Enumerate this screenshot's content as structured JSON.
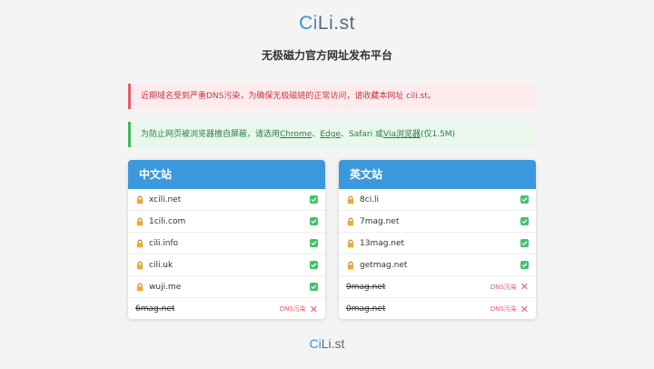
{
  "header": {
    "logo_prefix": "Ci",
    "logo_suffix": "Li.st",
    "subtitle": "无极磁力官方网址发布平台"
  },
  "alerts": {
    "warning": "近期域名受到严重DNS污染，为确保无极磁链的正常访问，请收藏本网址 cili.st。",
    "browser_prefix": "为防止网页被浏览器擅自屏蔽，请选用",
    "chrome": "Chrome",
    "sep1": "、",
    "edge": "Edge",
    "sep2": "、Safari 或",
    "via": "Via浏览器",
    "browser_suffix": "(仅1.5M)"
  },
  "cn_site": {
    "title": "中文站",
    "domains": [
      {
        "name": "xcili.net"
      },
      {
        "name": "1cili.com"
      },
      {
        "name": "cili.info"
      },
      {
        "name": "cili.uk"
      },
      {
        "name": "wuji.me"
      }
    ],
    "blocked": {
      "name": "6mag.net",
      "tag": "DNS污染"
    }
  },
  "en_site": {
    "title": "英文站",
    "domains": [
      {
        "name": "8ci.li"
      },
      {
        "name": "7mag.net"
      },
      {
        "name": "13mag.net"
      },
      {
        "name": "getmag.net"
      }
    ],
    "blocked": [
      {
        "name": "9mag.net",
        "tag": "DNS污染"
      },
      {
        "name": "0mag.net",
        "tag": "DNS污染"
      }
    ]
  },
  "footer": {
    "logo_prefix": "Ci",
    "logo_suffix": "Li.st"
  },
  "colors": {
    "accent": "#3b98dc",
    "ok": "#43c26b",
    "danger": "#e55a6b"
  }
}
